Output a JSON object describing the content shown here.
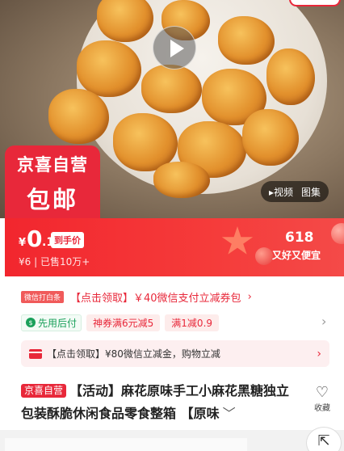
{
  "media": {
    "tabs": [
      "▸视频",
      "图集"
    ]
  },
  "badge": {
    "line1": "京喜自营",
    "line2": "包邮"
  },
  "price": {
    "currency": "¥",
    "integer": "0",
    "decimal": ".1",
    "tag": "到手价",
    "original": "¥6",
    "divider": "|",
    "sold": "已售10万+"
  },
  "festival": {
    "number": "618",
    "slogan": "又好又便宜"
  },
  "promo_wechat": {
    "tag": "微信打白条",
    "text": "【点击领取】￥40微信支付立减券包",
    "arrow": "›"
  },
  "promo_row": {
    "pay_later": "先用后付",
    "pay_icon": "dollar-icon",
    "coupons": [
      "神券满6元减5",
      "满1减0.9"
    ],
    "arrow": "›"
  },
  "notice": {
    "text": "【点击领取】¥80微信立减金，购物立减",
    "icon": "card-icon",
    "arrow": "›"
  },
  "product": {
    "tag": "京喜自营",
    "title": "【活动】麻花原味手工小麻花黑糖独立包装酥脆休闲食品零食整箱 【原味",
    "expand": "﹀"
  },
  "favorite": {
    "label": "收藏",
    "icon": "heart-icon"
  },
  "share": {
    "icon": "share-icon"
  },
  "colors": {
    "accent": "#e8283a",
    "green": "#1aa05a"
  }
}
